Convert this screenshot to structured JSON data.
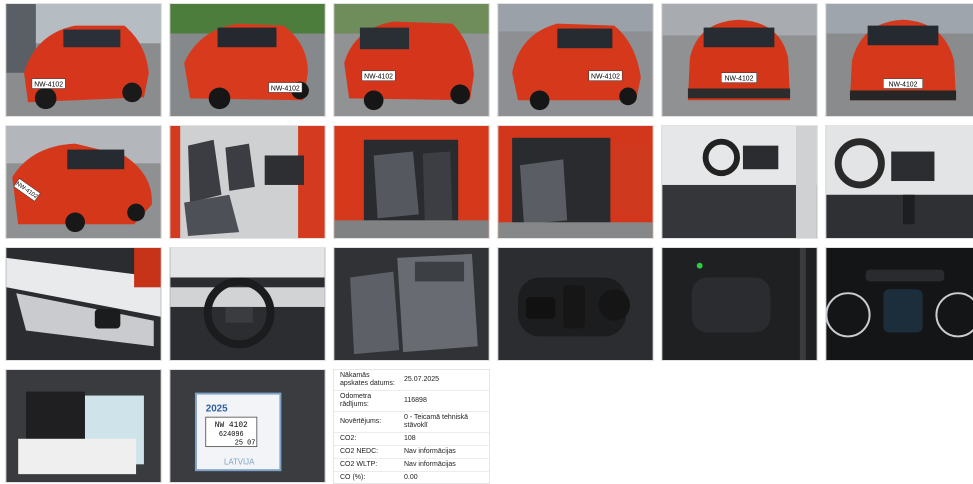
{
  "gallery": {
    "plates": {
      "p1": "NW-4102",
      "p2": "NW-4102",
      "p3": "NW-4102",
      "p4": "NW-4102",
      "p5": "NW-4102",
      "p6": "NW-4102",
      "p7": "NW-4102"
    },
    "inspection_sticker": {
      "plate": "NW 4102",
      "year": "2025",
      "code": "624096",
      "date": "25 07",
      "country": "LATVIJA"
    }
  },
  "specs": [
    {
      "label": "Nākamās apskates datums:",
      "value": "25.07.2025"
    },
    {
      "label": "Odometra rādījums:",
      "value": "116898"
    },
    {
      "label": "Novērtējums:",
      "value": "0 - Teicamā tehniskā stāvoklī"
    },
    {
      "label": "CO2:",
      "value": "108"
    },
    {
      "label": "CO2 NEDC:",
      "value": "Nav informācijas"
    },
    {
      "label": "CO2 WLTP:",
      "value": "Nav informācijas"
    },
    {
      "label": "CO (%):",
      "value": "0.00"
    }
  ],
  "colors": {
    "car_red": "#d6371c",
    "asphalt": "#8c8c8c",
    "interior_dark": "#2a2a2a"
  }
}
